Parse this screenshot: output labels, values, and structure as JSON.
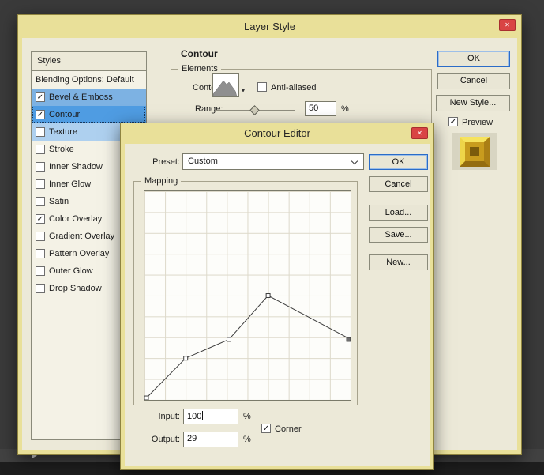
{
  "theme": {
    "desktop_bg": "#3a3a3a",
    "window_chrome": "#e9e099",
    "client_bg": "#ece9d8",
    "close_button_red": "#d94444",
    "selection_strong": "#4f9ce2",
    "selection_mid": "#7db2e3",
    "selection_light": "#aed0ef",
    "focus_blue": "#2b6cc8",
    "preview_gold": "#c89c1e"
  },
  "icons": {
    "close": "✕",
    "dropdown_small": "▾",
    "triangle": "▶"
  },
  "layer_style": {
    "title": "Layer Style",
    "styles_header": "Styles",
    "styles": [
      {
        "label": "Blending Options: Default",
        "check": null
      },
      {
        "label": "Bevel & Emboss",
        "check": "✓"
      },
      {
        "label": "Contour",
        "check": "✓"
      },
      {
        "label": "Texture",
        "check": ""
      },
      {
        "label": "Stroke",
        "check": ""
      },
      {
        "label": "Inner Shadow",
        "check": ""
      },
      {
        "label": "Inner Glow",
        "check": ""
      },
      {
        "label": "Satin",
        "check": ""
      },
      {
        "label": "Color Overlay",
        "check": "✓"
      },
      {
        "label": "Gradient Overlay",
        "check": ""
      },
      {
        "label": "Pattern Overlay",
        "check": ""
      },
      {
        "label": "Outer Glow",
        "check": ""
      },
      {
        "label": "Drop Shadow",
        "check": ""
      }
    ],
    "section_heading": "Contour",
    "elements_group": "Elements",
    "contour_label": "Contour:",
    "anti_aliased": {
      "label": "Anti-aliased",
      "check": ""
    },
    "range": {
      "label": "Range:",
      "value": "50",
      "unit": "%"
    },
    "ok": "OK",
    "cancel": "Cancel",
    "new_style": "New Style...",
    "preview": {
      "label": "Preview",
      "check": "✓"
    }
  },
  "contour_editor": {
    "title": "Contour Editor",
    "preset_label": "Preset:",
    "preset_value": "Custom",
    "mapping_group": "Mapping",
    "input": {
      "label": "Input:",
      "value": "100",
      "unit": "%"
    },
    "corner": {
      "label": "Corner",
      "check": "✓"
    },
    "output": {
      "label": "Output:",
      "value": "29",
      "unit": "%"
    },
    "ok": "OK",
    "cancel": "Cancel",
    "load": "Load...",
    "save": "Save...",
    "new": "New...",
    "curve": {
      "x_range": [
        0,
        100
      ],
      "y_range": [
        0,
        100
      ],
      "points": [
        {
          "input": 0,
          "output": 0
        },
        {
          "input": 20,
          "output": 20
        },
        {
          "input": 41,
          "output": 29
        },
        {
          "input": 60,
          "output": 50
        },
        {
          "input": 100,
          "output": 29
        }
      ],
      "selected_point_index": 4
    }
  }
}
